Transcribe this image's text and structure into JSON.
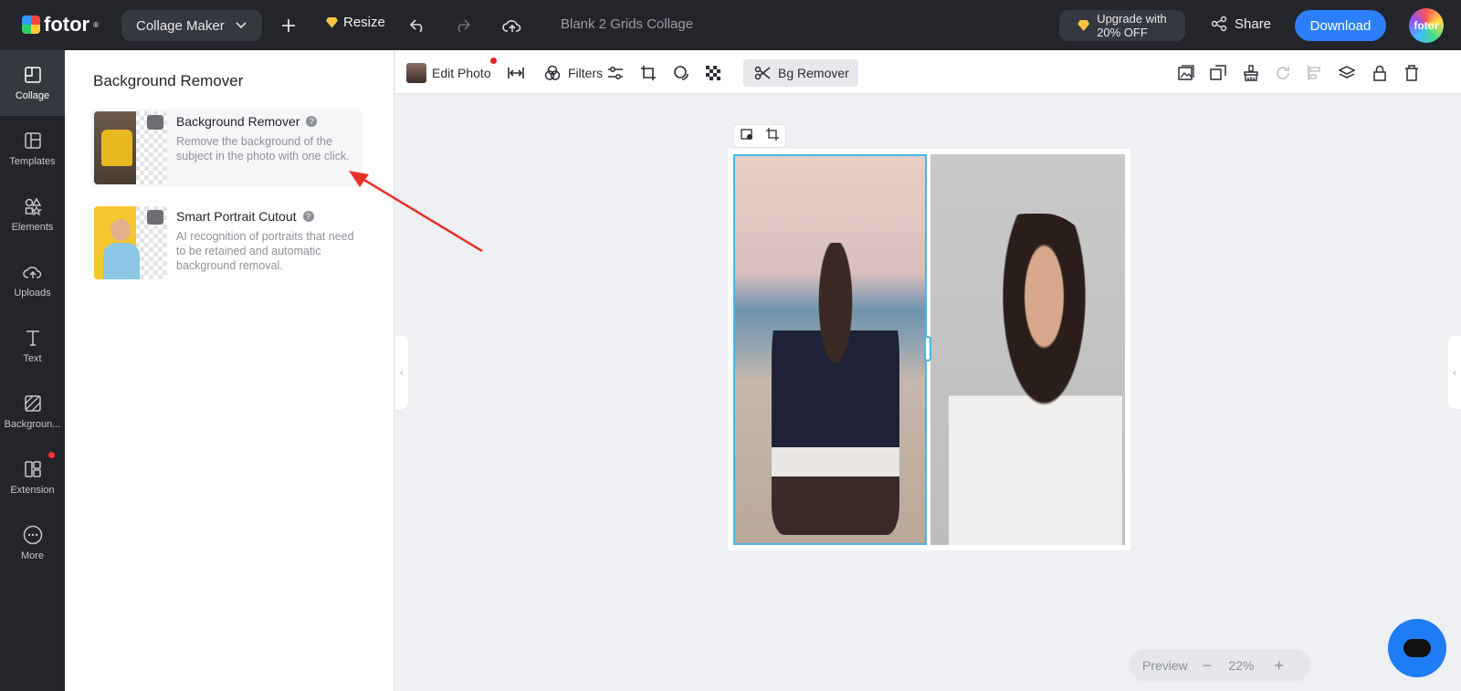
{
  "app": {
    "logo_text": "fotor",
    "trademark": "®"
  },
  "topbar": {
    "mode_label": "Collage Maker",
    "resize_label": "Resize",
    "doc_title": "Blank 2 Grids Collage",
    "upgrade_line1": "Upgrade with",
    "upgrade_line2": "20% OFF",
    "share_label": "Share",
    "download_label": "Download",
    "avatar_text": "fotor"
  },
  "leftnav": {
    "items": [
      {
        "label": "Collage",
        "icon": "collage-icon",
        "active": true
      },
      {
        "label": "Templates",
        "icon": "templates-icon"
      },
      {
        "label": "Elements",
        "icon": "elements-icon"
      },
      {
        "label": "Uploads",
        "icon": "upload-cloud-icon"
      },
      {
        "label": "Text",
        "icon": "text-icon"
      },
      {
        "label": "Backgroun...",
        "icon": "background-icon"
      },
      {
        "label": "Extension",
        "icon": "extension-icon",
        "badge": true
      },
      {
        "label": "More",
        "icon": "more-icon"
      }
    ]
  },
  "panel": {
    "title": "Background Remover",
    "tools": [
      {
        "name": "Background Remover",
        "desc": "Remove the background of the subject in the photo with one click."
      },
      {
        "name": "Smart Portrait Cutout",
        "desc": "AI recognition of portraits that need to be retained and automatic background removal."
      }
    ]
  },
  "toolbar2": {
    "edit_photo": "Edit Photo",
    "filters": "Filters",
    "bg_remover": "Bg Remover"
  },
  "zoom": {
    "preview_label": "Preview",
    "minus": "−",
    "value": "22%",
    "plus": "+"
  },
  "colors": {
    "accent": "#2d7ff9",
    "selection": "#47b6e6",
    "arrow": "#e8302a",
    "dark": "#23252b"
  }
}
